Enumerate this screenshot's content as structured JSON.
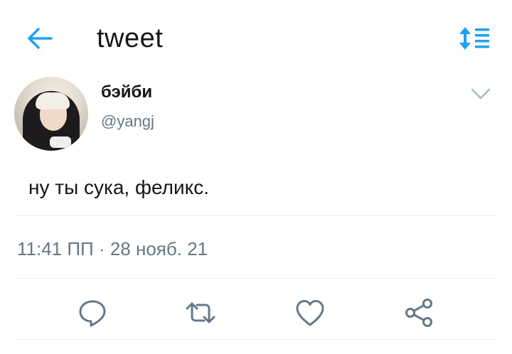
{
  "header": {
    "title": "tweet",
    "back_icon": "arrow-left-icon",
    "sort_icon": "sort-list-icon",
    "accent_color": "#1da1f2"
  },
  "tweet": {
    "display_name": "бэйби",
    "handle": "@yangj",
    "text": "ну ты сука, феликс.",
    "timestamp": "11:41 ПП · 28 нояб. 21"
  },
  "actions": [
    {
      "icon": "reply-icon"
    },
    {
      "icon": "retweet-icon"
    },
    {
      "icon": "like-icon"
    },
    {
      "icon": "share-icon"
    }
  ],
  "colors": {
    "text": "#14171a",
    "secondary": "#657786",
    "divider": "#e6ecf0"
  }
}
